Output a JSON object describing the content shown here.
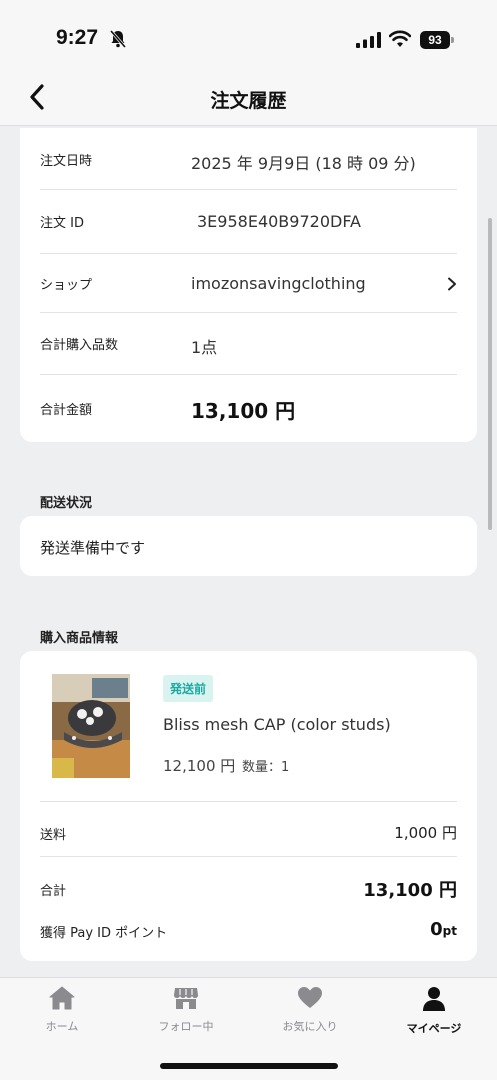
{
  "status_bar": {
    "time": "9:27",
    "battery": "93"
  },
  "nav": {
    "title": "注文履歴"
  },
  "order_info": {
    "date_label": "注文日時",
    "date_value": "2025 年 9月9日 (18 時 09 分)",
    "id_label": "注文 ID",
    "id_value": "3E958E40B9720DFA",
    "shop_label": "ショップ",
    "shop_value": "imozonsavingclothing",
    "count_label": "合計購入品数",
    "count_value": "1点",
    "total_label": "合計金額",
    "total_value": "13,100 円"
  },
  "shipping": {
    "section_title": "配送状況",
    "status": "発送準備中です"
  },
  "product": {
    "section_title": "購入商品情報",
    "badge": "発送前",
    "name": "Bliss mesh CAP (color studs)",
    "price": "12,100 円",
    "quantity": "数量：1"
  },
  "summary": {
    "shipping_label": "送料",
    "shipping_value": "1,000 円",
    "total_label": "合計",
    "total_value": "13,100 円",
    "points_label": "獲得 Pay ID ポイント",
    "points_value": "0",
    "points_unit": "pt"
  },
  "tabs": [
    {
      "label": "ホーム",
      "icon": "home-icon"
    },
    {
      "label": "フォロー中",
      "icon": "store-icon"
    },
    {
      "label": "お気に入り",
      "icon": "heart-icon"
    },
    {
      "label": "マイページ",
      "icon": "person-icon"
    }
  ],
  "colors": {
    "badge_bg": "#d9f3f1",
    "badge_text": "#1ea9a0",
    "page_bg": "#eeeff1"
  }
}
